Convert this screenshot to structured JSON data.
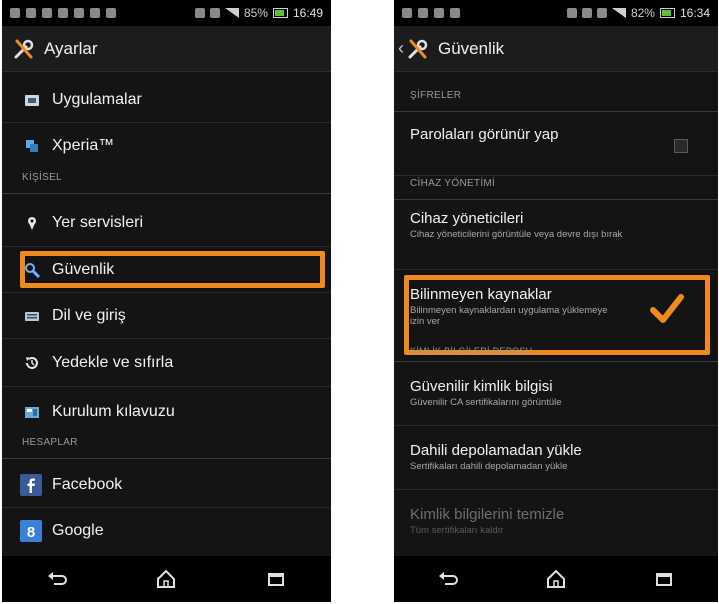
{
  "left": {
    "status": {
      "battery": "85%",
      "time": "16:49"
    },
    "title": "Ayarlar",
    "rows": [
      {
        "label": "Uygulamalar",
        "icon": "apps-icon"
      },
      {
        "label": "Xperia™",
        "icon": "xperia-icon"
      }
    ],
    "section_personal": "KİŞİSEL",
    "personal_rows": [
      {
        "label": "Yer servisleri",
        "icon": "location-pin-icon"
      },
      {
        "label": "Güvenlik",
        "icon": "lock-icon"
      },
      {
        "label": "Dil ve giriş",
        "icon": "keyboard-icon"
      },
      {
        "label": "Yedekle ve sıfırla",
        "icon": "backup-restore-icon"
      },
      {
        "label": "Kurulum kılavuzu",
        "icon": "setup-guide-icon"
      }
    ],
    "section_accounts": "HESAPLAR",
    "account_rows": [
      {
        "label": "Facebook",
        "icon": "facebook-icon"
      },
      {
        "label": "Google",
        "icon": "google-icon"
      }
    ]
  },
  "right": {
    "status": {
      "battery": "82%",
      "time": "16:34"
    },
    "title": "Güvenlik",
    "section_passwords": "ŞİFRELER",
    "visible_passwords": "Parolaları görünür yap",
    "section_device_admin": "CİHAZ YÖNETİMİ",
    "device_admins": {
      "title": "Cihaz yöneticileri",
      "subtitle": "Cihaz yöneticilerini görüntüle veya devre dışı bırak"
    },
    "unknown_sources": {
      "title": "Bilinmeyen kaynaklar",
      "subtitle": "Bilinmeyen kaynaklardan uygulama yüklemeye izin ver"
    },
    "section_credentials": "KİMLİK BİLGİLERİ DEPOSU",
    "trusted_credentials": {
      "title": "Güvenilir kimlik bilgisi",
      "subtitle": "Güvenilir CA sertifikalarını görüntüle"
    },
    "install_from_storage": {
      "title": "Dahili depolamadan yükle",
      "subtitle": "Sertifikaları dahili depolamadan yükle"
    },
    "clear_credentials": {
      "title": "Kimlik bilgilerini temizle",
      "subtitle": "Tüm sertifikaları kaldır"
    }
  },
  "colors": {
    "highlight": "#f08a1e",
    "background": "#141414"
  }
}
